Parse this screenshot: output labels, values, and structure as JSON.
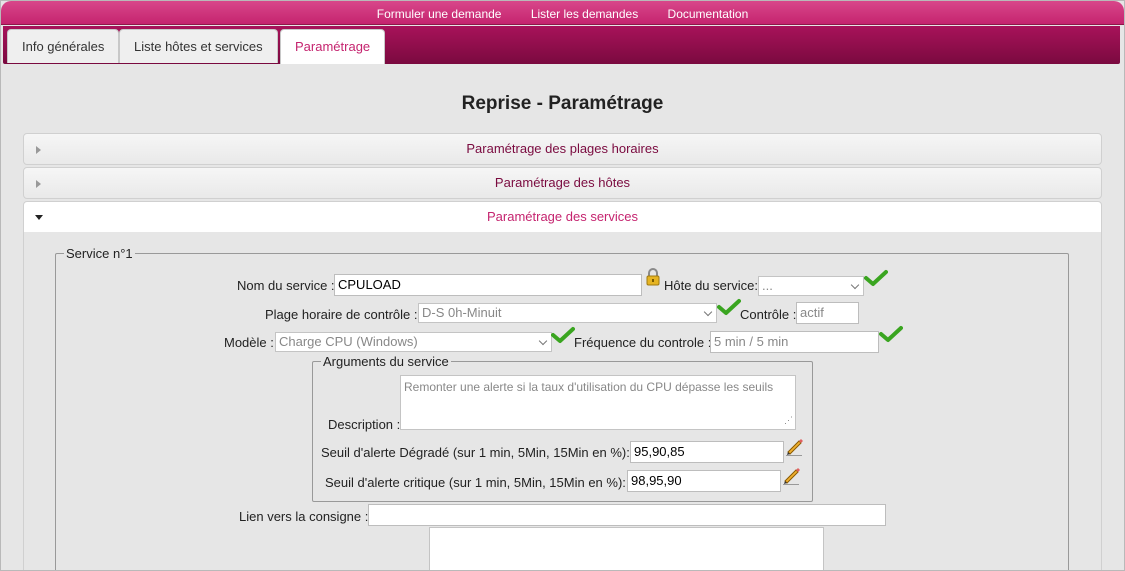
{
  "topnav": {
    "items": [
      "Formuler une demande",
      "Lister les demandes",
      "Documentation"
    ]
  },
  "tabs": [
    {
      "label": "Info générales"
    },
    {
      "label": "Liste hôtes et services"
    },
    {
      "label": "Paramétrage"
    }
  ],
  "page": {
    "title": "Reprise - Paramétrage"
  },
  "accordion": [
    {
      "label": "Paramétrage des plages horaires"
    },
    {
      "label": "Paramétrage des hôtes"
    },
    {
      "label": "Paramétrage des services"
    }
  ],
  "service": {
    "legend": "Service n°1",
    "nom_label": "Nom du service :",
    "nom_value": "CPULOAD",
    "hote_label": "Hôte du service:",
    "hote_value": "...",
    "plage_label": "Plage horaire de contrôle :",
    "plage_value": "D-S 0h-Minuit",
    "controle_label": "Contrôle :",
    "controle_value": "actif",
    "modele_label": "Modèle :",
    "modele_value": "Charge CPU (Windows)",
    "frequence_label": "Fréquence du controle :",
    "frequence_value": "5 min / 5 min",
    "lien_label": "Lien vers la consigne :",
    "lien_value": ""
  },
  "arguments": {
    "legend": "Arguments du service",
    "description_label": "Description :",
    "description_value": "Remonter une alerte si la taux d'utilisation du CPU dépasse les seuils",
    "degrade_label": "Seuil d'alerte Dégradé (sur 1 min, 5Min, 15Min en %):",
    "degrade_value": "95,90,85",
    "critique_label": "Seuil d'alerte critique (sur 1 min, 5Min, 15Min en %):",
    "critique_value": "98,95,90"
  },
  "colors": {
    "brand": "#c5246f",
    "brand_dark": "#7a0a3f",
    "check": "#3aa520"
  }
}
